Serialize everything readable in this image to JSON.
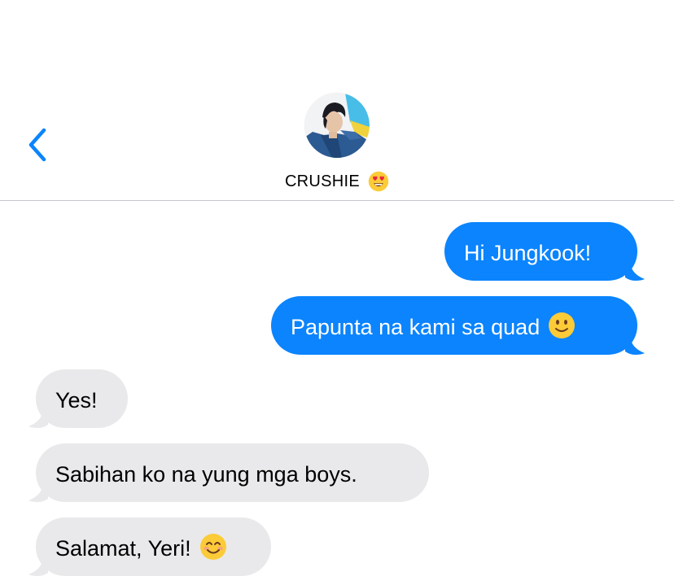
{
  "header": {
    "contact_name": "CRUSHIE",
    "contact_emoji": "heart-eyes-emoji",
    "back_icon": "chevron-left-icon",
    "avatar": "contact-avatar-photo"
  },
  "messages": [
    {
      "direction": "outgoing",
      "text": "Hi Jungkook!"
    },
    {
      "direction": "outgoing",
      "text": "Papunta na kami sa quad",
      "emoji": "slightly-smiling-face-emoji"
    },
    {
      "direction": "incoming",
      "text": "Yes!"
    },
    {
      "direction": "incoming",
      "text": "Sabihan ko na yung mga boys."
    },
    {
      "direction": "incoming",
      "text": "Salamat, Yeri!",
      "emoji": "smiling-face-with-smiling-eyes-emoji"
    }
  ],
  "colors": {
    "outgoing_bubble": "#0b84fe",
    "incoming_bubble": "#e9e9eb",
    "accent": "#0b84fe",
    "divider": "#c8c8cc"
  }
}
